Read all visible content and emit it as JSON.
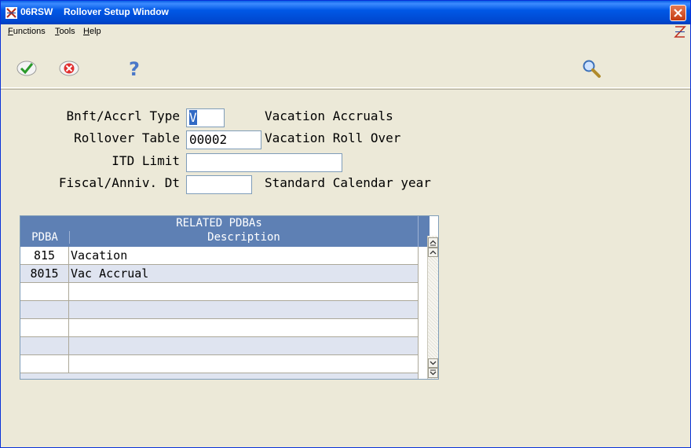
{
  "window": {
    "app_code": "06RSW",
    "title": "Rollover Setup Window"
  },
  "menu": {
    "items": [
      {
        "label": "Functions",
        "accel": "F"
      },
      {
        "label": "Tools",
        "accel": "T"
      },
      {
        "label": "Help",
        "accel": "H"
      }
    ]
  },
  "toolbar": {
    "ok_icon": "checkmark-icon",
    "cancel_icon": "x-cancel-icon",
    "help_icon": "question-mark-icon",
    "search_icon": "magnifier-icon"
  },
  "form": {
    "benefit_type": {
      "label": "Bnft/Accrl Type",
      "value": "V",
      "description": "Vacation Accruals"
    },
    "rollover_table": {
      "label": "Rollover Table",
      "value": "00002",
      "description": "Vacation Roll Over"
    },
    "itd_limit": {
      "label": "ITD Limit",
      "value": ""
    },
    "fiscal_anniv": {
      "label": "Fiscal/Anniv. Dt",
      "value": "",
      "description": "Standard Calendar year"
    }
  },
  "grid": {
    "title": "RELATED PDBAs",
    "columns": {
      "pdba": "PDBA",
      "description": "Description"
    },
    "rows": [
      {
        "pdba": "815",
        "description": "Vacation"
      },
      {
        "pdba": "8015",
        "description": "Vac Accrual"
      },
      {
        "pdba": "",
        "description": ""
      },
      {
        "pdba": "",
        "description": ""
      },
      {
        "pdba": "",
        "description": ""
      },
      {
        "pdba": "",
        "description": ""
      },
      {
        "pdba": "",
        "description": ""
      }
    ]
  },
  "colors": {
    "titlebar": "#0058e6",
    "grid_header": "#5e80b4",
    "selection": "#316ac5"
  }
}
